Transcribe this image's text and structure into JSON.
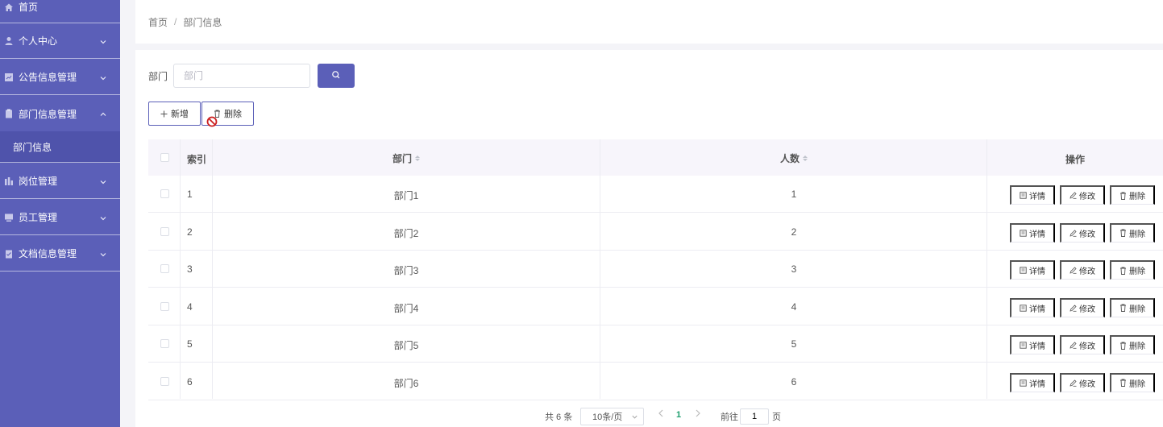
{
  "sidebar": {
    "items": [
      {
        "label": "首页",
        "icon": "home-icon"
      },
      {
        "label": "个人中心",
        "icon": "user-icon"
      },
      {
        "label": "公告信息管理",
        "icon": "chart-icon"
      },
      {
        "label": "部门信息管理",
        "icon": "clipboard-icon",
        "expanded": true
      },
      {
        "label": "岗位管理",
        "icon": "bars-icon"
      },
      {
        "label": "员工管理",
        "icon": "monitor-icon"
      },
      {
        "label": "文档信息管理",
        "icon": "checklist-icon"
      }
    ],
    "sub_item": "部门信息"
  },
  "breadcrumb": {
    "home": "首页",
    "separator": "/",
    "current": "部门信息"
  },
  "search": {
    "label": "部门",
    "placeholder": "部门"
  },
  "toolbar": {
    "add_label": "新增",
    "delete_label": "删除"
  },
  "table": {
    "headers": {
      "index": "索引",
      "department": "部门",
      "count": "人数",
      "actions": "操作"
    },
    "rows": [
      {
        "index": "1",
        "department": "部门1",
        "count": "1"
      },
      {
        "index": "2",
        "department": "部门2",
        "count": "2"
      },
      {
        "index": "3",
        "department": "部门3",
        "count": "3"
      },
      {
        "index": "4",
        "department": "部门4",
        "count": "4"
      },
      {
        "index": "5",
        "department": "部门5",
        "count": "5"
      },
      {
        "index": "6",
        "department": "部门6",
        "count": "6"
      }
    ],
    "actions": {
      "detail": "详情",
      "edit": "修改",
      "delete": "删除"
    }
  },
  "pagination": {
    "total_text": "共 6 条",
    "page_size": "10条/页",
    "current_page": "1",
    "goto_label": "前往",
    "goto_value": "1",
    "page_unit": "页"
  },
  "colors": {
    "accent": "#5b5fb8",
    "sidebar_active": "#4f53ab",
    "page_active": "#1e9e6e"
  }
}
